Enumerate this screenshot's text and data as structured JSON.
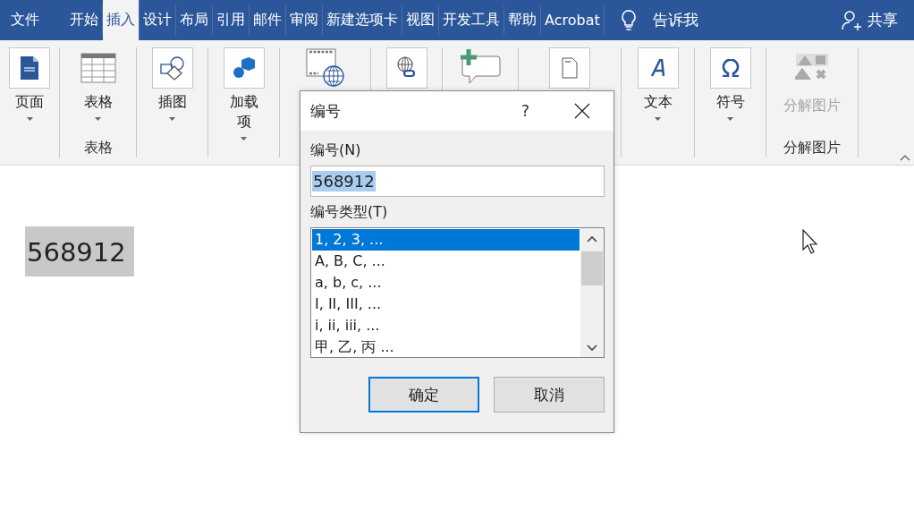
{
  "tabs": [
    {
      "label": "文件",
      "selected": false
    },
    {
      "label": "开始",
      "selected": false
    },
    {
      "label": "插入",
      "selected": true
    },
    {
      "label": "设计",
      "selected": false
    },
    {
      "label": "布局",
      "selected": false
    },
    {
      "label": "引用",
      "selected": false
    },
    {
      "label": "邮件",
      "selected": false
    },
    {
      "label": "审阅",
      "selected": false
    },
    {
      "label": "新建选项卡",
      "selected": false
    },
    {
      "label": "视图",
      "selected": false
    },
    {
      "label": "开发工具",
      "selected": false
    },
    {
      "label": "帮助",
      "selected": false
    },
    {
      "label": "Acrobat",
      "selected": false
    }
  ],
  "tell_me": "告诉我",
  "share": "共享",
  "ribbon_groups": [
    {
      "items": [
        {
          "kind": "page",
          "label": "页面",
          "dropdown": true,
          "disabled": false
        }
      ]
    },
    {
      "label": "表格",
      "items": [
        {
          "kind": "table",
          "label": "表格",
          "dropdown": true,
          "disabled": false
        }
      ]
    },
    {
      "items": [
        {
          "kind": "shapes",
          "label": "插图",
          "dropdown": true,
          "disabled": false
        }
      ]
    },
    {
      "items": [
        {
          "kind": "addin",
          "label": "加载项",
          "dropdown": true,
          "disabled": false
        }
      ]
    },
    {
      "items": [
        {
          "kind": "video"
        }
      ]
    },
    {
      "items": [
        {
          "kind": "link"
        }
      ]
    },
    {
      "items": [
        {
          "kind": "comment"
        }
      ]
    },
    {
      "items": [
        {
          "kind": "header"
        }
      ]
    },
    {
      "items": [
        {
          "kind": "text",
          "label": "文本",
          "dropdown": true,
          "disabled": false
        }
      ]
    },
    {
      "items": [
        {
          "kind": "symbol",
          "label": "符号",
          "dropdown": true,
          "disabled": false
        }
      ]
    },
    {
      "label": "分解图片",
      "items": [
        {
          "kind": "picture",
          "label": "分解图片",
          "dropdown": false,
          "disabled": true
        }
      ]
    }
  ],
  "document": {
    "text": "568912",
    "highlighted": true
  },
  "dialog": {
    "title": "编号",
    "help": "?",
    "number_label": "编号(N)",
    "number_value": "568912",
    "type_label": "编号类型(T)",
    "types": [
      {
        "label": "1, 2, 3, ...",
        "selected": true
      },
      {
        "label": "A, B, C, ...",
        "selected": false
      },
      {
        "label": "a, b, c, ...",
        "selected": false
      },
      {
        "label": "I, II, III, ...",
        "selected": false
      },
      {
        "label": "i, ii, iii, ...",
        "selected": false
      },
      {
        "label": "甲, 乙, 丙 ...",
        "selected": false
      }
    ],
    "buttons": [
      {
        "label": "确定",
        "default": true
      },
      {
        "label": "取消",
        "default": false
      }
    ]
  }
}
